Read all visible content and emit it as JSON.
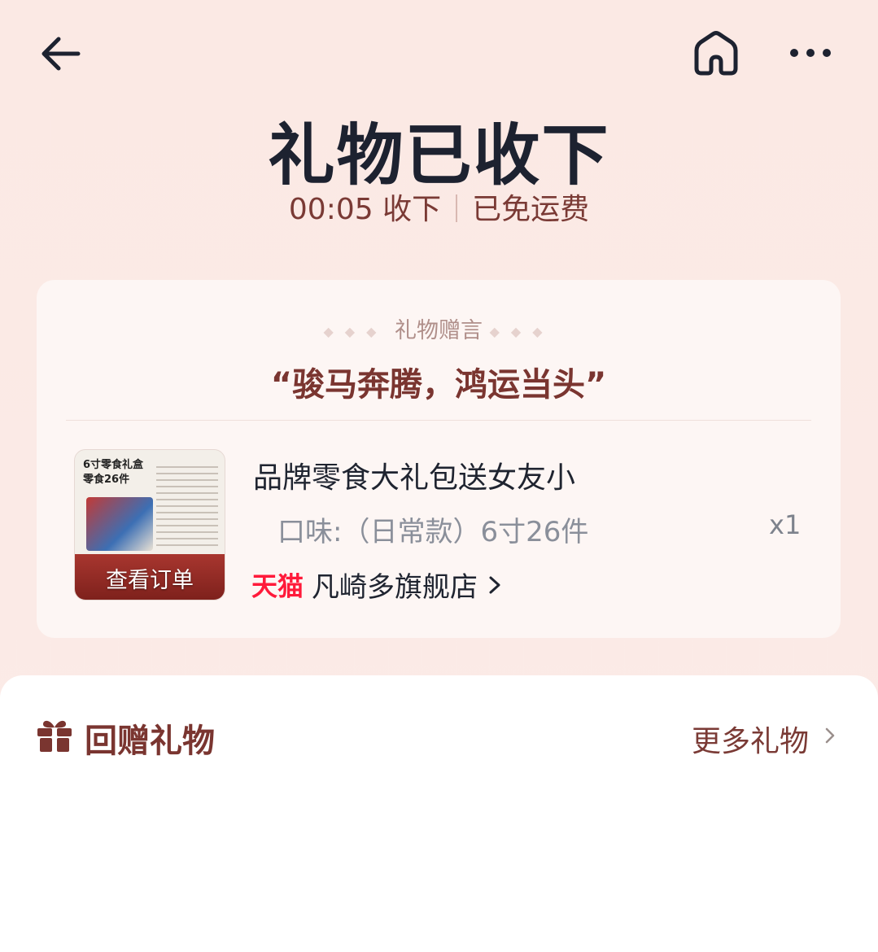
{
  "header": {
    "back_icon": "arrow-left-icon",
    "home_icon": "home-icon",
    "more_icon": "more-horizontal-icon"
  },
  "status": {
    "title": "礼物已收下",
    "received_time": "00:05 收下",
    "shipping_note": "已免运费"
  },
  "gift_message": {
    "label": "礼物赠言",
    "text": "“骏马奔腾，鸿运当头”"
  },
  "product": {
    "thumb_overlay_label": "查看订单",
    "thumb_caption": "6寸零食礼盒\n零食26件",
    "name": "品牌零食大礼包送女友小",
    "spec": "口味:（日常款）6寸26件",
    "quantity": "x1",
    "platform": "天猫",
    "store_name": "凡崎多旗舰店"
  },
  "return_gift": {
    "title": "回赠礼物",
    "more_label": "更多礼物",
    "icon": "gift-icon"
  },
  "colors": {
    "accent_brown": "#7a3530",
    "tmall_red": "#ff1a3a",
    "title_dark": "#1d2230"
  }
}
